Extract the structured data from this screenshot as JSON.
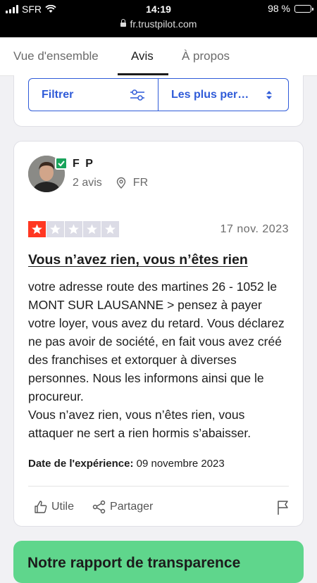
{
  "status_bar": {
    "carrier": "SFR",
    "time": "14:19",
    "battery": "98 %",
    "battery_level": 0.98,
    "url": "fr.trustpilot.com"
  },
  "tabs": [
    {
      "label": "Vue d'ensemble",
      "active": false
    },
    {
      "label": "Avis",
      "active": true
    },
    {
      "label": "À propos",
      "active": false
    }
  ],
  "filters": {
    "filter_label": "Filtrer",
    "sort_label": "Les plus per…"
  },
  "review": {
    "reviewer_name": "F P",
    "review_count": "2 avis",
    "country": "FR",
    "rating": 1,
    "rating_max": 5,
    "date": "17 nov. 2023",
    "title": "Vous n’avez rien, vous n’êtes rien",
    "body": "votre adresse route des martines 26 - 1052 le MONT SUR LAUSANNE > pensez à payer votre loyer, vous avez du retard. Vous déclarez ne pas avoir de société, en fait vous avez créé des franchises et extorquer à diverses personnes. Nous les informons ainsi que le procureur.\nVous n’avez rien, vous n’êtes rien, vous attaquer ne sert a rien hormis s’abaisser.",
    "experience_label": "Date de l'expérience:",
    "experience_date": "09 novembre 2023",
    "useful_label": "Utile",
    "share_label": "Partager"
  },
  "banner": {
    "text": "Notre rapport de transparence"
  },
  "colors": {
    "accent": "#2f5bd8",
    "star_on": "#ff3722",
    "star_off": "#dcdce6",
    "banner": "#5fd68c",
    "verified": "#19a35b"
  }
}
